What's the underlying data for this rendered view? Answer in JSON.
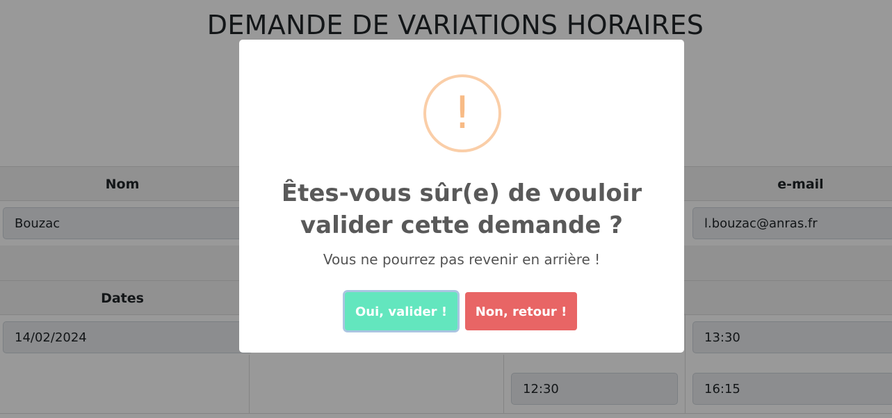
{
  "page": {
    "title": "DEMANDE DE VARIATIONS HORAIRES"
  },
  "form": {
    "headers": {
      "nom": "Nom",
      "email": "e-mail",
      "dates": "Dates"
    },
    "values": {
      "nom": "Bouzac",
      "email": "l.bouzac@anras.fr",
      "date_1": "14/02/2024",
      "time_1": "13:30",
      "time_2": "12:30",
      "time_3": "16:15"
    }
  },
  "modal": {
    "icon": "warning-exclamation-icon",
    "icon_glyph": "!",
    "title": "Êtes-vous sûr(e) de vouloir valider cette demande ?",
    "text": "Vous ne pourrez pas revenir en arrière !",
    "confirm_label": "Oui, valider !",
    "cancel_label": "Non, retour !",
    "colors": {
      "confirm": "#63e6be",
      "cancel": "#e86565",
      "icon": "#f8bb86"
    }
  }
}
